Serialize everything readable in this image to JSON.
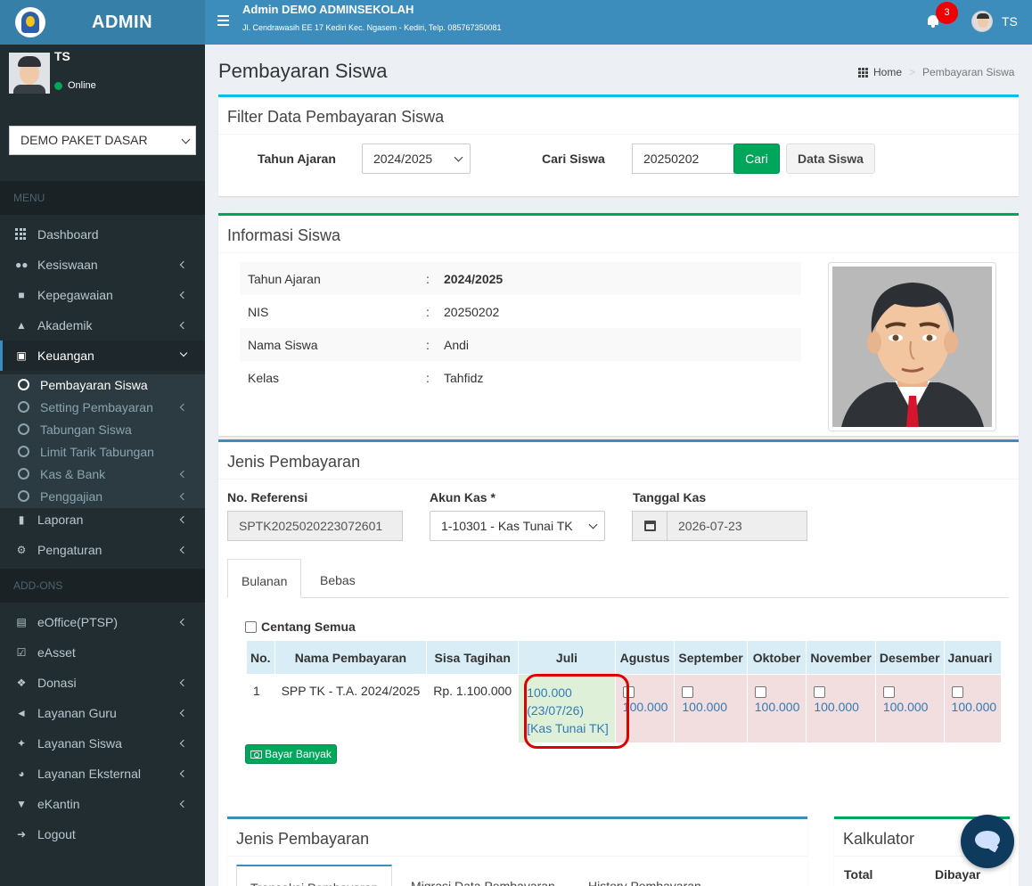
{
  "app": {
    "logo_text": "ADMIN"
  },
  "header": {
    "school_name": "Admin DEMO ADMINSEKOLAH",
    "school_address": "Jl. Cendrawasih EE 17 Kediri Kec. Ngasem - Kediri, Telp. 085767350081",
    "notification_count": "3",
    "user_initials": "TS"
  },
  "sidebar": {
    "user_name": "TS",
    "user_status": "Online",
    "package_value": "DEMO PAKET DASAR",
    "menu_header": "MENU",
    "addons_header": "ADD-ONS",
    "items": [
      {
        "label": "Dashboard",
        "icon": "dashboard-icon"
      },
      {
        "label": "Kesiswaan",
        "icon": "users-icon"
      },
      {
        "label": "Kepegawaian",
        "icon": "briefcase-icon"
      },
      {
        "label": "Akademik",
        "icon": "graduation-cap-icon"
      },
      {
        "label": "Keuangan",
        "icon": "money-icon"
      },
      {
        "label": "Laporan",
        "icon": "file-icon"
      },
      {
        "label": "Pengaturan",
        "icon": "gear-icon"
      }
    ],
    "keuangan_sub": [
      {
        "label": "Pembayaran Siswa"
      },
      {
        "label": "Setting Pembayaran"
      },
      {
        "label": "Tabungan Siswa"
      },
      {
        "label": "Limit Tarik Tabungan"
      },
      {
        "label": "Kas & Bank"
      },
      {
        "label": "Penggajian"
      }
    ],
    "addons": [
      {
        "label": "eOffice(PTSP)",
        "icon": "inbox-icon"
      },
      {
        "label": "eAsset",
        "icon": "check-square-icon"
      },
      {
        "label": "Donasi",
        "icon": "dropbox-icon"
      },
      {
        "label": "Layanan Guru",
        "icon": "bullhorn-icon"
      },
      {
        "label": "Layanan Siswa",
        "icon": "child-icon"
      },
      {
        "label": "Layanan Eksternal",
        "icon": "rss-icon"
      },
      {
        "label": "eKantin",
        "icon": "cart-icon"
      },
      {
        "label": "Logout",
        "icon": "sign-out-icon"
      }
    ]
  },
  "page": {
    "title": "Pembayaran Siswa",
    "breadcrumb_home": "Home",
    "breadcrumb_current": "Pembayaran Siswa"
  },
  "filter": {
    "title": "Filter Data Pembayaran Siswa",
    "tahun_label": "Tahun Ajaran",
    "tahun_value": "2024/2025",
    "cari_label": "Cari Siswa",
    "cari_value": "20250202",
    "cari_button": "Cari",
    "data_siswa_button": "Data Siswa"
  },
  "info": {
    "title": "Informasi Siswa",
    "rows": [
      {
        "key": "Tahun Ajaran",
        "colon": ":",
        "value": "2024/2025"
      },
      {
        "key": "NIS",
        "colon": ":",
        "value": "20250202"
      },
      {
        "key": "Nama Siswa",
        "colon": ":",
        "value": "Andi"
      },
      {
        "key": "Kelas",
        "colon": ":",
        "value": "Tahfidz"
      }
    ]
  },
  "jenis": {
    "title": "Jenis Pembayaran",
    "ref_label": "No. Referensi",
    "ref_value": "SPTK20250202230726​01",
    "akun_label": "Akun Kas *",
    "akun_value": "1-10301 - Kas Tunai TK",
    "tanggal_label": "Tanggal Kas",
    "tanggal_value": "2026-07-23",
    "tabs": [
      "Bulanan",
      "Bebas"
    ],
    "centang_label": "Centang Semua",
    "table": {
      "headers": [
        "No.",
        "Nama Pembayaran",
        "Sisa Tagihan",
        "Juli",
        "Agustus",
        "September",
        "Oktober",
        "November",
        "Desember",
        "Januari"
      ],
      "row": {
        "no": "1",
        "nama": "SPP TK - T.A. 2024/2025",
        "sisa": "Rp. 1.100.000",
        "juli_amount": "100.000",
        "juli_date": "(23/07/26)",
        "juli_kas": "[Kas Tunai TK]",
        "unpaid": [
          "100.000",
          "100.000",
          "100.000",
          "100.000",
          "100.000",
          "100.000"
        ]
      }
    },
    "bayar_banyak": "Bayar Banyak"
  },
  "lower": {
    "title": "Jenis Pembayaran",
    "tabs": [
      "Transaksi Pembayaran",
      "Migrasi Data Pembayaran",
      "History Pembayaran"
    ],
    "kalkulator_title": "Kalkulator",
    "total_label": "Total",
    "dibayar_label": "Dibayar"
  },
  "colors": {
    "header": "#3c8dbc",
    "logo": "#367fa9",
    "sidebar": "#222d32",
    "green": "#00a65a",
    "highlight": "#e00000"
  }
}
